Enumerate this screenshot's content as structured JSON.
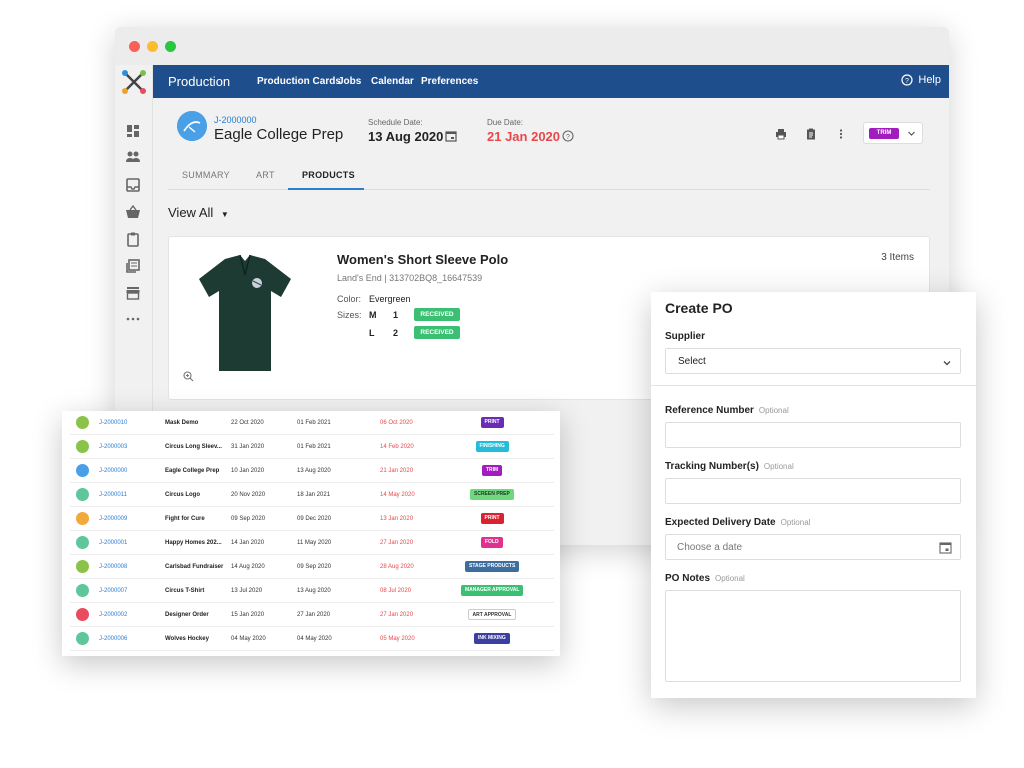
{
  "app": {
    "title": "Production",
    "nav": [
      "Production Cards",
      "Jobs",
      "Calendar",
      "Preferences"
    ],
    "help": "Help"
  },
  "job": {
    "id": "J-2000000",
    "name": "Eagle College Prep",
    "schedule_label": "Schedule Date:",
    "schedule_date": "13 Aug 2020",
    "due_label": "Due Date:",
    "due_date": "21 Jan 2020",
    "status": "TRIM",
    "status_color": "#a21dbd"
  },
  "tabs": [
    "SUMMARY",
    "ART",
    "PRODUCTS"
  ],
  "view_all": "View All",
  "product": {
    "title": "Women's Short Sleeve Polo",
    "subtitle": "Land's End | 313702BQ8_16647539",
    "items": "3 Items",
    "color_label": "Color:",
    "color_value": "Evergreen",
    "sizes_label": "Sizes:",
    "sizes": [
      {
        "size": "M",
        "qty": "1",
        "status": "RECEIVED"
      },
      {
        "size": "L",
        "qty": "2",
        "status": "RECEIVED"
      }
    ]
  },
  "jobs_table": [
    {
      "id": "J-2000010",
      "name": "Mask Demo",
      "d1": "22 Oct 2020",
      "d2": "01 Feb 2021",
      "d3": "06 Oct 2020",
      "status": "PRINT",
      "color": "#6a2bb5",
      "text": "#ffffff",
      "avatar": "#8bc34a"
    },
    {
      "id": "J-2000003",
      "name": "Circus Long Sleev...",
      "d1": "31 Jan 2020",
      "d2": "01 Feb 2021",
      "d3": "14 Feb 2020",
      "status": "FINISHING",
      "color": "#26bcd7",
      "text": "#ffffff",
      "avatar": "#8bc34a"
    },
    {
      "id": "J-2000000",
      "name": "Eagle College Prep",
      "d1": "10 Jan 2020",
      "d2": "13 Aug 2020",
      "d3": "21 Jan 2020",
      "status": "TRIM",
      "color": "#a21dbd",
      "text": "#ffffff",
      "avatar": "#4aa0e6"
    },
    {
      "id": "J-2000011",
      "name": "Circus Logo",
      "d1": "20 Nov 2020",
      "d2": "18 Jan 2021",
      "d3": "14 May 2020",
      "status": "SCREEN PREP",
      "color": "#6fd77d",
      "text": "#1b3b1f",
      "avatar": "#5ec69a"
    },
    {
      "id": "J-2000009",
      "name": "Fight for Cure",
      "d1": "09 Sep 2020",
      "d2": "09 Dec 2020",
      "d3": "13 Jan 2020",
      "status": "PRINT",
      "color": "#d9232e",
      "text": "#ffffff",
      "avatar": "#f2a93b"
    },
    {
      "id": "J-2000001",
      "name": "Happy Homes 202...",
      "d1": "14 Jan 2020",
      "d2": "11 May 2020",
      "d3": "27 Jan 2020",
      "status": "FOLD",
      "color": "#e0318f",
      "text": "#ffffff",
      "avatar": "#5ec69a"
    },
    {
      "id": "J-2000008",
      "name": "Carlsbad Fundraiser",
      "d1": "14 Aug 2020",
      "d2": "09 Sep 2020",
      "d3": "28 Aug 2020",
      "status": "STAGE PRODUCTS",
      "color": "#3d6e9e",
      "text": "#ffffff",
      "avatar": "#8bc34a"
    },
    {
      "id": "J-2000007",
      "name": "Circus T-Shirt",
      "d1": "13 Jul 2020",
      "d2": "13 Aug 2020",
      "d3": "08 Jul 2020",
      "status": "MANAGER APPROVAL",
      "color": "#3bbf73",
      "text": "#ffffff",
      "avatar": "#5ec69a"
    },
    {
      "id": "J-2000002",
      "name": "Designer Order",
      "d1": "15 Jan 2020",
      "d2": "27 Jan 2020",
      "d3": "27 Jan 2020",
      "status": "ART APPROVAL",
      "color": "#ffffff",
      "text": "#333333",
      "avatar": "#e84c5e"
    },
    {
      "id": "J-2000006",
      "name": "Wolves Hockey",
      "d1": "04 May 2020",
      "d2": "04 May 2020",
      "d3": "05 May 2020",
      "status": "INK MIXING",
      "color": "#3a3fa0",
      "text": "#ffffff",
      "avatar": "#5ec69a"
    }
  ],
  "po": {
    "title": "Create PO",
    "supplier_label": "Supplier",
    "supplier_value": "Select",
    "ref_label": "Reference Number",
    "tracking_label": "Tracking Number(s)",
    "delivery_label": "Expected Delivery Date",
    "delivery_placeholder": "Choose a date",
    "notes_label": "PO Notes",
    "optional": "Optional"
  },
  "icons": {
    "sidebar": [
      "dashboard-icon",
      "people-icon",
      "inbox-icon",
      "basket-icon",
      "clipboard-icon",
      "library-icon",
      "store-icon",
      "more-icon"
    ],
    "header_tools": [
      "print-icon",
      "clipboard-icon",
      "more-vert-icon"
    ]
  }
}
